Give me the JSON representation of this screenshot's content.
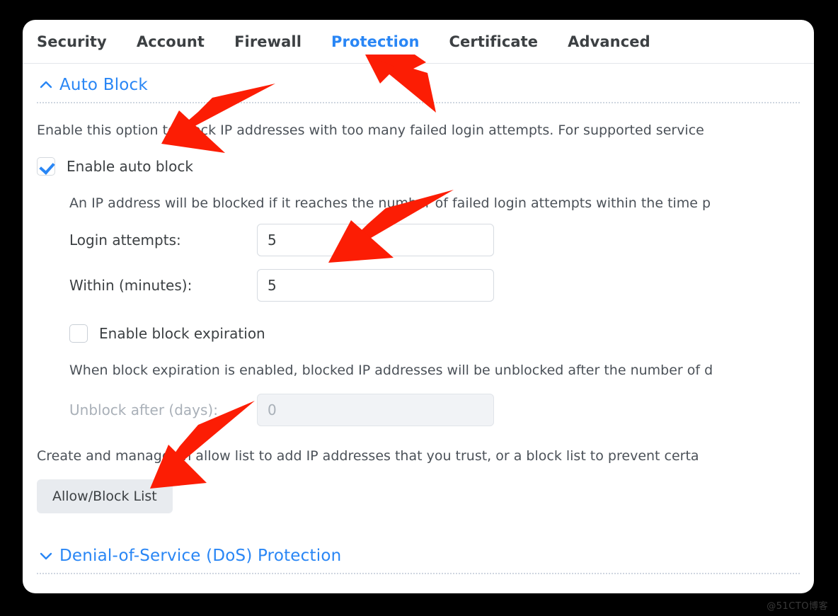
{
  "window": {
    "tabs": [
      {
        "label": "Security",
        "active": false
      },
      {
        "label": "Account",
        "active": false
      },
      {
        "label": "Firewall",
        "active": false
      },
      {
        "label": "Protection",
        "active": true
      },
      {
        "label": "Certificate",
        "active": false
      },
      {
        "label": "Advanced",
        "active": false
      }
    ]
  },
  "auto_block": {
    "title": "Auto Block",
    "chevron": "chevron-up-icon",
    "description": "Enable this option to block IP addresses with too many failed login attempts. For supported service",
    "enable_checkbox": {
      "label": "Enable auto block",
      "checked": true
    },
    "enable_note": "An IP address will be blocked if it reaches the number of failed login attempts within the time p",
    "login_attempts": {
      "label": "Login attempts:",
      "value": "5"
    },
    "within_minutes": {
      "label": "Within (minutes):",
      "value": "5"
    },
    "block_expiration_checkbox": {
      "label": "Enable block expiration",
      "checked": false
    },
    "expiration_note": "When block expiration is enabled, blocked IP addresses will be unblocked after the number of d",
    "unblock_after": {
      "label": "Unblock after (days):",
      "value": "0",
      "disabled": true
    },
    "allow_block_note": "Create and manage an allow list to add IP addresses that you trust, or a block list to prevent certa",
    "allow_block_button": "Allow/Block List"
  },
  "dos": {
    "title": "Denial-of-Service (DoS) Protection",
    "chevron": "chevron-down-icon"
  },
  "annotations": {
    "arrow_color": "#fc1d04",
    "count": 4
  },
  "watermark": "@51CTO博客"
}
